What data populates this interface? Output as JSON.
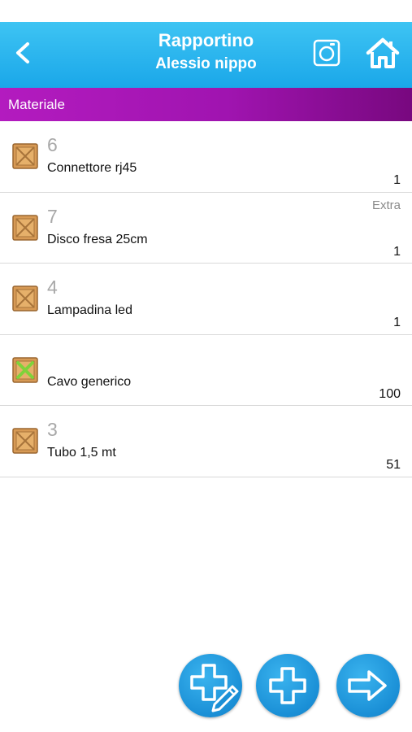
{
  "header": {
    "title": "Rapportino",
    "subtitle": "Alessio nippo",
    "back_icon": "chevron-left-icon",
    "camera_icon": "camera-icon",
    "home_icon": "home-icon"
  },
  "section": {
    "label": "Materiale"
  },
  "items": [
    {
      "code": "6",
      "name": "Connettore rj45",
      "qty": "1",
      "extra": "",
      "icon": "crate-icon"
    },
    {
      "code": "7",
      "name": "Disco fresa 25cm",
      "qty": "1",
      "extra": "Extra",
      "icon": "crate-icon"
    },
    {
      "code": "4",
      "name": "Lampadina led",
      "qty": "1",
      "extra": "",
      "icon": "crate-icon"
    },
    {
      "code": "",
      "name": "Cavo generico",
      "qty": "100",
      "extra": "",
      "icon": "crate-green-x-icon"
    },
    {
      "code": "3",
      "name": "Tubo 1,5 mt",
      "qty": "51",
      "extra": "",
      "icon": "crate-icon"
    }
  ],
  "actions": {
    "edit_add_icon": "plus-pencil-icon",
    "add_icon": "plus-icon",
    "next_icon": "arrow-right-icon"
  },
  "colors": {
    "header_blue": "#1aa7e9",
    "section_purple": "#a014b0",
    "fab_blue": "#1a8fd6"
  }
}
